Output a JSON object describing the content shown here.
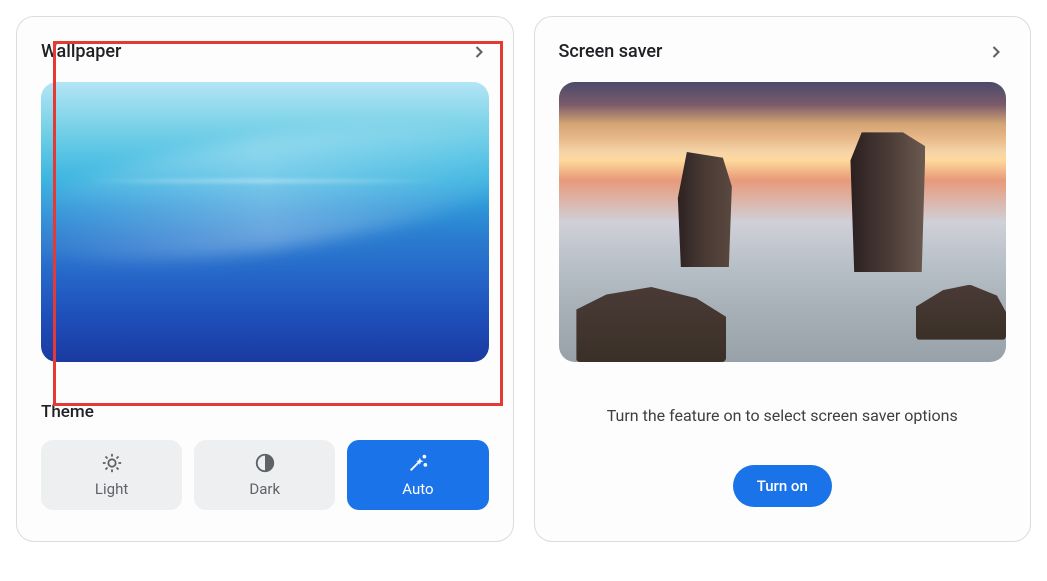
{
  "wallpaper": {
    "title": "Wallpaper"
  },
  "theme": {
    "title": "Theme",
    "options": {
      "light": "Light",
      "dark": "Dark",
      "auto": "Auto"
    }
  },
  "screensaver": {
    "title": "Screen saver",
    "info": "Turn the feature on to select screen saver options",
    "button": "Turn on"
  }
}
